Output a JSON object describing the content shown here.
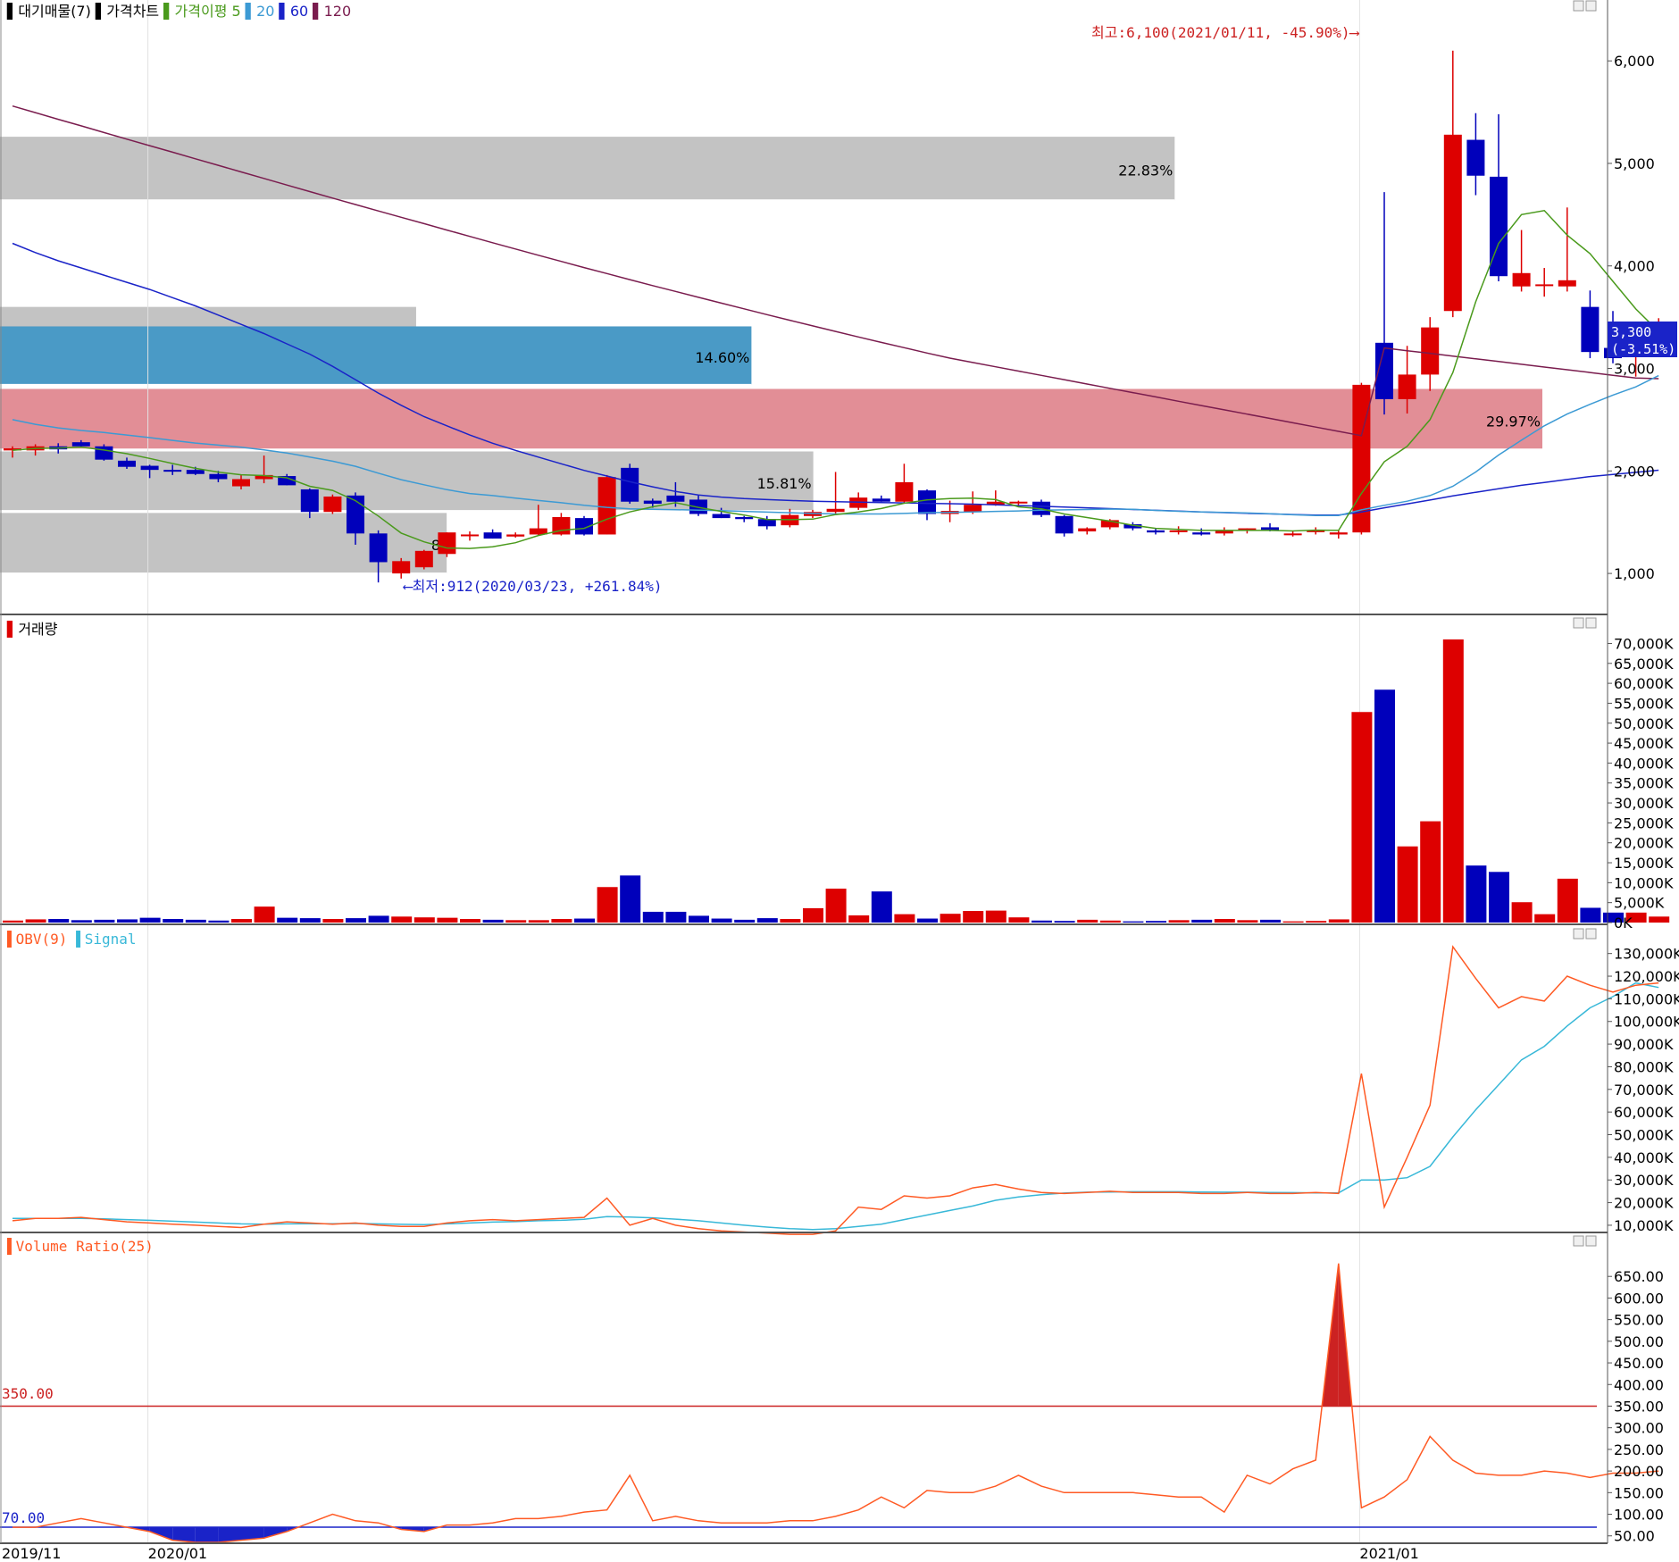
{
  "colors": {
    "up": "#dd0000",
    "down": "#0000bb",
    "ma5": "#4a9a1c",
    "ma20": "#3c9ad4",
    "ma60": "#1a23c8",
    "ma120": "#7a1c4e",
    "obv": "#ff5a24",
    "signal": "#38b8d8",
    "vr": "#ff5a24",
    "level_high": "#cc2222",
    "level_low": "#1a23c8",
    "axis_text": "#000000",
    "profile_gray": "#c3c3c3",
    "profile_blue": "#4a9ac6",
    "profile_red": "#e28e96"
  },
  "legends": {
    "price": [
      {
        "marker": "#000000",
        "text": "대기매물(7)"
      },
      {
        "marker": "#000000",
        "text": "가격차트"
      },
      {
        "marker": "#4a9a1c",
        "text": "가격이평 5",
        "color": "#4a9a1c"
      },
      {
        "marker": "#3c9ad4",
        "text": "20",
        "color": "#3c9ad4"
      },
      {
        "marker": "#1a23c8",
        "text": "60",
        "color": "#1a23c8"
      },
      {
        "marker": "#7a1c4e",
        "text": "120",
        "color": "#7a1c4e"
      }
    ],
    "volume": [
      {
        "marker": "#dd0000",
        "text": "거래량",
        "color": "#000000"
      }
    ],
    "obv": [
      {
        "marker": "#ff5a24",
        "text": "OBV(9)",
        "color": "#ff5a24"
      },
      {
        "marker": "#38b8d8",
        "text": "Signal",
        "color": "#38b8d8"
      }
    ],
    "vr": [
      {
        "marker": "#ff5a24",
        "text": "Volume Ratio(25)",
        "color": "#ff5a24"
      }
    ]
  },
  "annotations": {
    "high": "최고:6,100(2021/01/11, -45.90%)⟶",
    "low": "⟵최저:912(2020/03/23, +261.84%)",
    "last_price": "3,300",
    "last_change": "(-3.51%)",
    "vr_upper": "350.00",
    "vr_lower": "70.00"
  },
  "chart_data": [
    {
      "type": "candlestick",
      "title": "가격차트",
      "timeframe": "weekly",
      "ylim": [
        600,
        6350
      ],
      "yticks": [
        1000,
        2000,
        3000,
        4000,
        5000,
        6000
      ],
      "ytick_labels": [
        "1,000",
        "2,000",
        "3,000",
        "4,000",
        "5,000",
        "6,000"
      ],
      "x_labels": [
        {
          "index": 0,
          "label": "2019/11"
        },
        {
          "index": 6,
          "label": "2020/01"
        },
        {
          "index": 59,
          "label": "2021/01"
        }
      ],
      "ohlc": [
        [
          2200,
          2240,
          2130,
          2220
        ],
        [
          2200,
          2260,
          2150,
          2240
        ],
        [
          2240,
          2270,
          2170,
          2210
        ],
        [
          2280,
          2300,
          2230,
          2240
        ],
        [
          2240,
          2260,
          2100,
          2110
        ],
        [
          2100,
          2130,
          2020,
          2040
        ],
        [
          2050,
          2060,
          1930,
          2010
        ],
        [
          2010,
          2060,
          1960,
          2000
        ],
        [
          2010,
          2040,
          1960,
          1970
        ],
        [
          1970,
          2000,
          1890,
          1920
        ],
        [
          1850,
          1960,
          1820,
          1920
        ],
        [
          1920,
          2150,
          1880,
          1960
        ],
        [
          1950,
          1970,
          1860,
          1860
        ],
        [
          1820,
          1830,
          1540,
          1600
        ],
        [
          1600,
          1770,
          1580,
          1750
        ],
        [
          1760,
          1790,
          1280,
          1390
        ],
        [
          1390,
          1420,
          912,
          1110
        ],
        [
          1000,
          1150,
          950,
          1120
        ],
        [
          1060,
          1230,
          1040,
          1220
        ],
        [
          1190,
          1400,
          1160,
          1400
        ],
        [
          1380,
          1410,
          1320,
          1380
        ],
        [
          1400,
          1430,
          1340,
          1340
        ],
        [
          1360,
          1400,
          1350,
          1380
        ],
        [
          1380,
          1670,
          1370,
          1440
        ],
        [
          1380,
          1590,
          1370,
          1550
        ],
        [
          1540,
          1560,
          1370,
          1380
        ],
        [
          1380,
          1960,
          1380,
          1940
        ],
        [
          2030,
          2070,
          1680,
          1700
        ],
        [
          1710,
          1730,
          1640,
          1680
        ],
        [
          1760,
          1890,
          1650,
          1700
        ],
        [
          1720,
          1760,
          1560,
          1580
        ],
        [
          1580,
          1640,
          1540,
          1540
        ],
        [
          1550,
          1560,
          1500,
          1530
        ],
        [
          1530,
          1560,
          1430,
          1460
        ],
        [
          1470,
          1630,
          1450,
          1570
        ],
        [
          1560,
          1620,
          1540,
          1600
        ],
        [
          1600,
          1990,
          1580,
          1630
        ],
        [
          1640,
          1790,
          1620,
          1740
        ],
        [
          1730,
          1760,
          1700,
          1700
        ],
        [
          1700,
          2070,
          1690,
          1890
        ],
        [
          1810,
          1820,
          1520,
          1580
        ],
        [
          1580,
          1710,
          1500,
          1610
        ],
        [
          1600,
          1800,
          1580,
          1670
        ],
        [
          1670,
          1810,
          1660,
          1700
        ],
        [
          1700,
          1710,
          1650,
          1700
        ],
        [
          1700,
          1720,
          1550,
          1570
        ],
        [
          1560,
          1570,
          1360,
          1390
        ],
        [
          1410,
          1450,
          1380,
          1440
        ],
        [
          1450,
          1530,
          1430,
          1520
        ],
        [
          1480,
          1500,
          1420,
          1440
        ],
        [
          1420,
          1440,
          1380,
          1400
        ],
        [
          1420,
          1460,
          1380,
          1420
        ],
        [
          1400,
          1440,
          1370,
          1380
        ],
        [
          1390,
          1450,
          1370,
          1420
        ],
        [
          1420,
          1440,
          1390,
          1440
        ],
        [
          1450,
          1490,
          1410,
          1420
        ],
        [
          1380,
          1410,
          1360,
          1390
        ],
        [
          1410,
          1450,
          1380,
          1420
        ],
        [
          1380,
          1420,
          1340,
          1400
        ],
        [
          1400,
          2860,
          1380,
          2840
        ],
        [
          3250,
          4720,
          2550,
          2700
        ],
        [
          2700,
          3220,
          2560,
          2940
        ],
        [
          2940,
          3500,
          2780,
          3400
        ],
        [
          3560,
          6100,
          3500,
          5280
        ],
        [
          5230,
          5490,
          4690,
          4880
        ],
        [
          4870,
          5480,
          3850,
          3900
        ],
        [
          3800,
          4350,
          3750,
          3930
        ],
        [
          3820,
          3980,
          3700,
          3820
        ],
        [
          3800,
          4570,
          3750,
          3860
        ],
        [
          3600,
          3760,
          3100,
          3160
        ],
        [
          3200,
          3560,
          3050,
          3100
        ],
        [
          3140,
          3390,
          2920,
          3300
        ],
        [
          3300,
          3490,
          3200,
          3300
        ]
      ],
      "ma5": [
        2200,
        2220,
        2223,
        2233,
        2204,
        2168,
        2122,
        2072,
        2025,
        1989,
        1963,
        1955,
        1933,
        1850,
        1810,
        1710,
        1560,
        1394,
        1308,
        1248,
        1244,
        1260,
        1300,
        1370,
        1420,
        1440,
        1530,
        1600,
        1650,
        1690,
        1645,
        1605,
        1570,
        1527,
        1524,
        1530,
        1574,
        1600,
        1633,
        1685,
        1718,
        1730,
        1734,
        1720,
        1650,
        1630,
        1580,
        1545,
        1510,
        1470,
        1440,
        1430,
        1420,
        1420,
        1420,
        1420,
        1415,
        1422,
        1420,
        1780,
        2090,
        2240,
        2500,
        2960,
        3650,
        4220,
        4500,
        4540,
        4300,
        4120,
        3850,
        3580,
        3360
      ],
      "ma20": [
        2500,
        2455,
        2420,
        2395,
        2375,
        2350,
        2325,
        2298,
        2272,
        2252,
        2232,
        2205,
        2175,
        2135,
        2095,
        2045,
        1978,
        1915,
        1865,
        1817,
        1780,
        1760,
        1735,
        1712,
        1690,
        1665,
        1645,
        1630,
        1625,
        1622,
        1618,
        1612,
        1605,
        1598,
        1592,
        1585,
        1580,
        1580,
        1580,
        1585,
        1593,
        1596,
        1600,
        1605,
        1610,
        1617,
        1620,
        1624,
        1628,
        1625,
        1615,
        1606,
        1600,
        1595,
        1590,
        1583,
        1572,
        1565,
        1565,
        1620,
        1665,
        1705,
        1760,
        1850,
        1990,
        2155,
        2300,
        2440,
        2555,
        2650,
        2740,
        2820,
        2930
      ],
      "ma60": [
        4220,
        4130,
        4050,
        3980,
        3910,
        3840,
        3770,
        3690,
        3610,
        3520,
        3430,
        3340,
        3240,
        3140,
        3020,
        2890,
        2760,
        2640,
        2530,
        2440,
        2350,
        2270,
        2200,
        2135,
        2070,
        2005,
        1950,
        1895,
        1845,
        1800,
        1765,
        1745,
        1730,
        1720,
        1712,
        1705,
        1700,
        1696,
        1692,
        1688,
        1684,
        1680,
        1676,
        1670,
        1662,
        1655,
        1648,
        1640,
        1632,
        1624,
        1616,
        1608,
        1600,
        1593,
        1586,
        1581,
        1575,
        1570,
        1570,
        1600,
        1640,
        1678,
        1716,
        1756,
        1792,
        1826,
        1860,
        1888,
        1916,
        1945,
        1966,
        1986,
        2007
      ],
      "ma120": [
        5560,
        5495,
        5430,
        5366,
        5301,
        5237,
        5173,
        5109,
        5045,
        4981,
        4917,
        4853,
        4789,
        4725,
        4662,
        4599,
        4536,
        4474,
        4412,
        4350,
        4288,
        4226,
        4165,
        4104,
        4044,
        3984,
        3925,
        3866,
        3808,
        3751,
        3694,
        3637,
        3581,
        3525,
        3470,
        3415,
        3361,
        3307,
        3254,
        3202,
        3150,
        3100,
        3058,
        3016,
        2974,
        2932,
        2890,
        2848,
        2806,
        2764,
        2722,
        2680,
        2638,
        2596,
        2554,
        2512,
        2470,
        2428,
        2386,
        2344,
        3200,
        3173,
        3147,
        3120,
        3093,
        3067,
        3040,
        3013,
        2987,
        2960,
        2933,
        2907,
        2900
      ]
    },
    {
      "type": "bar",
      "title": "거래량",
      "unit": "K",
      "ylim": [
        0,
        71000
      ],
      "yticks": [
        0,
        5000,
        10000,
        15000,
        20000,
        25000,
        30000,
        35000,
        40000,
        45000,
        50000,
        55000,
        60000,
        65000,
        70000
      ],
      "ytick_labels": [
        "0K",
        "5,000K",
        "10,000K",
        "15,000K",
        "20,000K",
        "25,000K",
        "30,000K",
        "35,000K",
        "40,000K",
        "45,000K",
        "50,000K",
        "55,000K",
        "60,000K",
        "65,000K",
        "70,000K"
      ],
      "values": [
        500,
        800,
        900,
        600,
        700,
        800,
        1200,
        900,
        700,
        500,
        900,
        4000,
        1200,
        1100,
        900,
        1100,
        1700,
        1500,
        1300,
        1200,
        900,
        700,
        600,
        600,
        900,
        1000,
        8900,
        11800,
        2700,
        2700,
        1700,
        1000,
        700,
        1100,
        900,
        3600,
        8500,
        1800,
        7800,
        2100,
        1000,
        2200,
        2900,
        3000,
        1300,
        500,
        400,
        700,
        500,
        300,
        400,
        600,
        700,
        900,
        600,
        700,
        300,
        400,
        800,
        52800,
        58400,
        19100,
        25400,
        71000,
        14300,
        12700,
        5100,
        2100,
        11000,
        3700,
        2500,
        2500,
        1500
      ]
    },
    {
      "type": "line",
      "title": "OBV(9)",
      "unit": "K",
      "ylim": [
        8000,
        135000
      ],
      "yticks": [
        10000,
        20000,
        30000,
        40000,
        50000,
        60000,
        70000,
        80000,
        90000,
        100000,
        110000,
        120000,
        130000
      ],
      "ytick_labels": [
        "10,000K",
        "20,000K",
        "30,000K",
        "40,000K",
        "50,000K",
        "60,000K",
        "70,000K",
        "80,000K",
        "90,000K",
        "100,000K",
        "110,000K",
        "120,000K",
        "130,000K"
      ],
      "series": [
        {
          "name": "OBV(9)",
          "values": [
            12000,
            13000,
            13000,
            13500,
            12500,
            11500,
            11000,
            10500,
            10000,
            9500,
            9000,
            10500,
            11500,
            11000,
            10500,
            11000,
            10000,
            9500,
            9500,
            11000,
            12000,
            12500,
            12000,
            12500,
            13000,
            13500,
            22000,
            10000,
            13000,
            10000,
            8500,
            7500,
            7000,
            6500,
            6000,
            6000,
            7500,
            18000,
            17000,
            23000,
            22000,
            23000,
            26500,
            28000,
            26000,
            24500,
            24000,
            24500,
            25000,
            24500,
            24500,
            24500,
            24000,
            24000,
            24500,
            24000,
            24000,
            24500,
            24000,
            77000,
            18000,
            40000,
            63000,
            133000,
            119000,
            106000,
            111000,
            109000,
            120000,
            116000,
            113000,
            116000,
            117000
          ]
        },
        {
          "name": "Signal",
          "values": [
            13000,
            13000,
            13000,
            13000,
            12800,
            12500,
            12200,
            11800,
            11400,
            11000,
            10600,
            10500,
            10600,
            10700,
            10700,
            10800,
            10600,
            10400,
            10300,
            10600,
            11000,
            11400,
            11600,
            12000,
            12200,
            12600,
            13800,
            13600,
            13300,
            12700,
            12000,
            11000,
            10000,
            9200,
            8500,
            8100,
            8500,
            9500,
            10500,
            12500,
            14500,
            16500,
            18500,
            21000,
            22500,
            23500,
            24200,
            24600,
            24700,
            24800,
            24800,
            24800,
            24700,
            24600,
            24600,
            24500,
            24400,
            24300,
            24300,
            30000,
            30000,
            31000,
            36000,
            49000,
            61000,
            72000,
            83000,
            89000,
            98000,
            106000,
            111000,
            117000,
            115000
          ]
        }
      ]
    },
    {
      "type": "line",
      "title": "Volume Ratio(25)",
      "ylim": [
        35,
        700
      ],
      "yticks": [
        50,
        100,
        150,
        200,
        250,
        300,
        350,
        400,
        450,
        500,
        550,
        600,
        650
      ],
      "ytick_labels": [
        "50.00",
        "100.00",
        "150.00",
        "200.00",
        "250.00",
        "300.00",
        "350.00",
        "400.00",
        "450.00",
        "500.00",
        "550.00",
        "600.00",
        "650.00"
      ],
      "levels": [
        350,
        70
      ],
      "values": [
        70,
        70,
        80,
        90,
        80,
        70,
        60,
        40,
        35,
        35,
        40,
        45,
        60,
        80,
        100,
        85,
        80,
        65,
        60,
        75,
        75,
        80,
        90,
        90,
        95,
        105,
        110,
        190,
        85,
        95,
        85,
        80,
        80,
        80,
        85,
        85,
        95,
        110,
        140,
        115,
        155,
        150,
        150,
        165,
        190,
        165,
        150,
        150,
        150,
        150,
        145,
        140,
        140,
        105,
        190,
        170,
        205,
        225,
        680,
        115,
        140,
        180,
        280,
        225,
        195,
        190,
        190,
        200,
        195,
        185,
        195,
        195,
        200
      ]
    }
  ]
}
